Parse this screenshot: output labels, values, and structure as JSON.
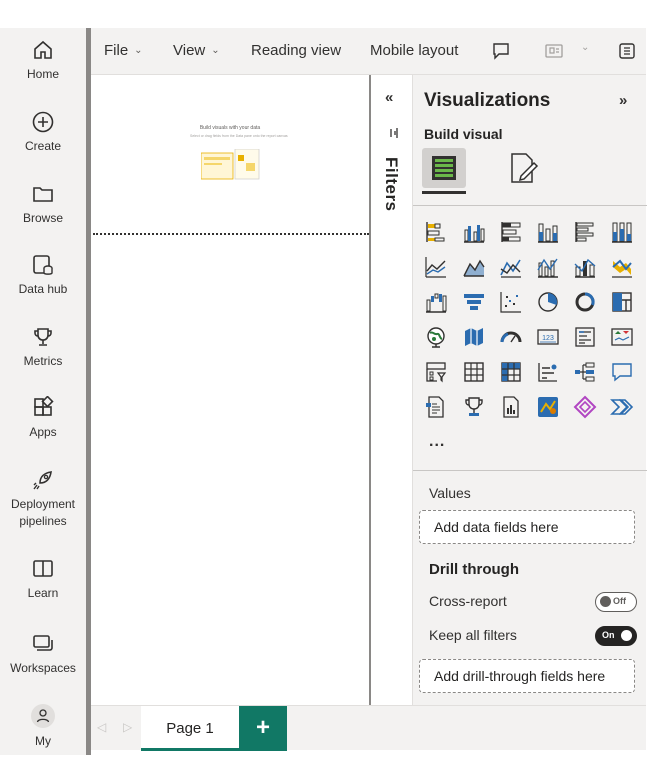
{
  "nav": {
    "items": [
      {
        "label": "Home",
        "icon": "home-icon"
      },
      {
        "label": "Create",
        "icon": "plus-circle-icon"
      },
      {
        "label": "Browse",
        "icon": "folder-icon"
      },
      {
        "label": "Data hub",
        "icon": "data-hub-icon"
      },
      {
        "label": "Metrics",
        "icon": "trophy-icon"
      },
      {
        "label": "Apps",
        "icon": "apps-icon"
      },
      {
        "label": "Deployment pipelines",
        "icon": "rocket-icon"
      },
      {
        "label": "Learn",
        "icon": "book-icon"
      },
      {
        "label": "Workspaces",
        "icon": "workspaces-icon"
      },
      {
        "label": "My",
        "icon": "person-icon"
      }
    ]
  },
  "menubar": {
    "file": "File",
    "view": "View",
    "reading_view": "Reading view",
    "mobile_layout": "Mobile layout"
  },
  "canvas": {
    "thumb_title": "Build visuals with your data",
    "thumb_subtitle": "Select or drag fields from the Data pane onto the report canvas"
  },
  "filters": {
    "label": "Filters"
  },
  "visualizations": {
    "title": "Visualizations",
    "build_label": "Build visual",
    "more": "...",
    "icons": [
      "stacked-bar-chart-icon",
      "clustered-bar-chart-icon",
      "100-stacked-bar-chart-icon",
      "stacked-column-chart-icon",
      "clustered-column-chart-icon",
      "100-stacked-column-chart-icon",
      "line-chart-icon",
      "area-chart-icon",
      "stacked-area-chart-icon",
      "line-clustered-column-chart-icon",
      "line-stacked-column-chart-icon",
      "ribbon-chart-icon",
      "waterfall-chart-icon",
      "funnel-chart-icon",
      "scatter-chart-icon",
      "pie-chart-icon",
      "donut-chart-icon",
      "treemap-icon",
      "map-icon",
      "filled-map-icon",
      "gauge-icon",
      "card-icon",
      "multi-row-card-icon",
      "kpi-icon",
      "slicer-icon",
      "table-icon",
      "matrix-icon",
      "key-influencers-icon",
      "decomposition-tree-icon",
      "qna-icon",
      "paginated-report-icon",
      "goals-icon",
      "smart-narrative-icon",
      "azure-map-icon",
      "power-apps-icon",
      "power-automate-icon"
    ]
  },
  "fields": {
    "values_label": "Values",
    "values_placeholder": "Add data fields here",
    "drill_title": "Drill through",
    "cross_report_label": "Cross-report",
    "cross_report_state": "Off",
    "keep_filters_label": "Keep all filters",
    "keep_filters_state": "On",
    "drill_placeholder": "Add drill-through fields here"
  },
  "pages": {
    "prev": "◁",
    "next": "▷",
    "tab_label": "Page 1",
    "add_label": "+"
  },
  "colors": {
    "accent_green": "#117865",
    "viz_blue": "#2b6cb0",
    "viz_yellow": "#e8b000",
    "viz_orange": "#d97b00",
    "viz_purple": "#b146c2"
  }
}
